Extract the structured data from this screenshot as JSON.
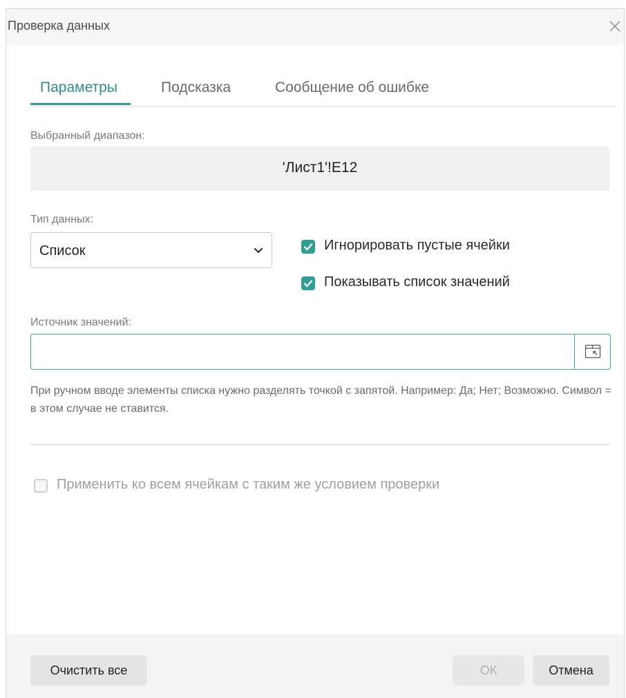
{
  "dialog": {
    "title": "Проверка данных",
    "close_icon": "close-icon"
  },
  "tabs": [
    {
      "label": "Параметры",
      "active": true
    },
    {
      "label": "Подсказка",
      "active": false
    },
    {
      "label": "Сообщение об ошибке",
      "active": false
    }
  ],
  "range": {
    "label": "Выбранный диапазон:",
    "value": "'Лист1'!E12"
  },
  "data_type": {
    "label": "Тип данных:",
    "selected": "Список",
    "chevron_icon": "chevron-down-icon"
  },
  "options": {
    "ignore_blank": {
      "label": "Игнорировать пустые ячейки",
      "checked": true
    },
    "show_list": {
      "label": "Показывать список значений",
      "checked": true
    }
  },
  "source": {
    "label": "Источник значений:",
    "value": "",
    "picker_icon": "select-range-icon"
  },
  "hint": "При ручном вводе элементы списка нужно разделять точкой с запятой. Например: Да; Нет; Возможно. Символ = в этом случае не ставится.",
  "apply_all": {
    "label": "Применить ко всем ячейкам с таким же условием проверки",
    "checked": false,
    "disabled": true
  },
  "footer": {
    "clear_label": "Очистить все",
    "ok_label": "ОК",
    "cancel_label": "Отмена"
  },
  "colors": {
    "accent": "#2f9f95",
    "active_tab_text": "#2f8f88"
  }
}
